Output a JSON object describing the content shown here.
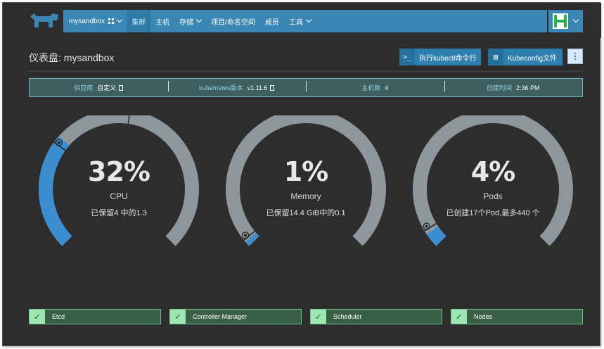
{
  "nav": {
    "cluster_name": "mysandbox",
    "items": [
      {
        "label": "集群"
      },
      {
        "label": "主机"
      },
      {
        "label": "存储"
      },
      {
        "label": "项目/命名空间"
      },
      {
        "label": "成员"
      },
      {
        "label": "工具"
      }
    ]
  },
  "header": {
    "title": "仪表盘: mysandbox",
    "kubectl_button": "执行kubectl命令行",
    "kubeconfig_button": "Kubeconfig文件"
  },
  "info": {
    "provider_key": "供应商",
    "provider_value": "自定义",
    "k8s_key": "kubernetes版本",
    "k8s_value": "v1.11.6",
    "hosts_key": "主机数",
    "hosts_value": "4",
    "created_key": "创建时间",
    "created_value": "2:36 PM"
  },
  "gauges": [
    {
      "label": "CPU",
      "value": "32%",
      "percent": 32,
      "reserved_fraction": 0.3,
      "sub": "已保留4 中的1.3",
      "color": "#3b8fd0"
    },
    {
      "label": "Memory",
      "value": "1%",
      "percent": 1,
      "reserved_fraction": 0.01,
      "sub": "已保留14.4 GiB中的0.1",
      "color": "#3b8fd0"
    },
    {
      "label": "Pods",
      "value": "4%",
      "percent": 4,
      "reserved_fraction": 0.04,
      "sub": "已创建17个Pod,最多440 个",
      "color": "#3b8fd0"
    }
  ],
  "status": [
    {
      "label": "Etcd"
    },
    {
      "label": "Controller Manager"
    },
    {
      "label": "Scheduler"
    },
    {
      "label": "Nodes"
    }
  ],
  "colors": {
    "navbar": "#3a86b4",
    "gauge_track": "#8e979b",
    "gauge_fill": "#3b8fd0",
    "status_ok": "#9ee6b4"
  }
}
